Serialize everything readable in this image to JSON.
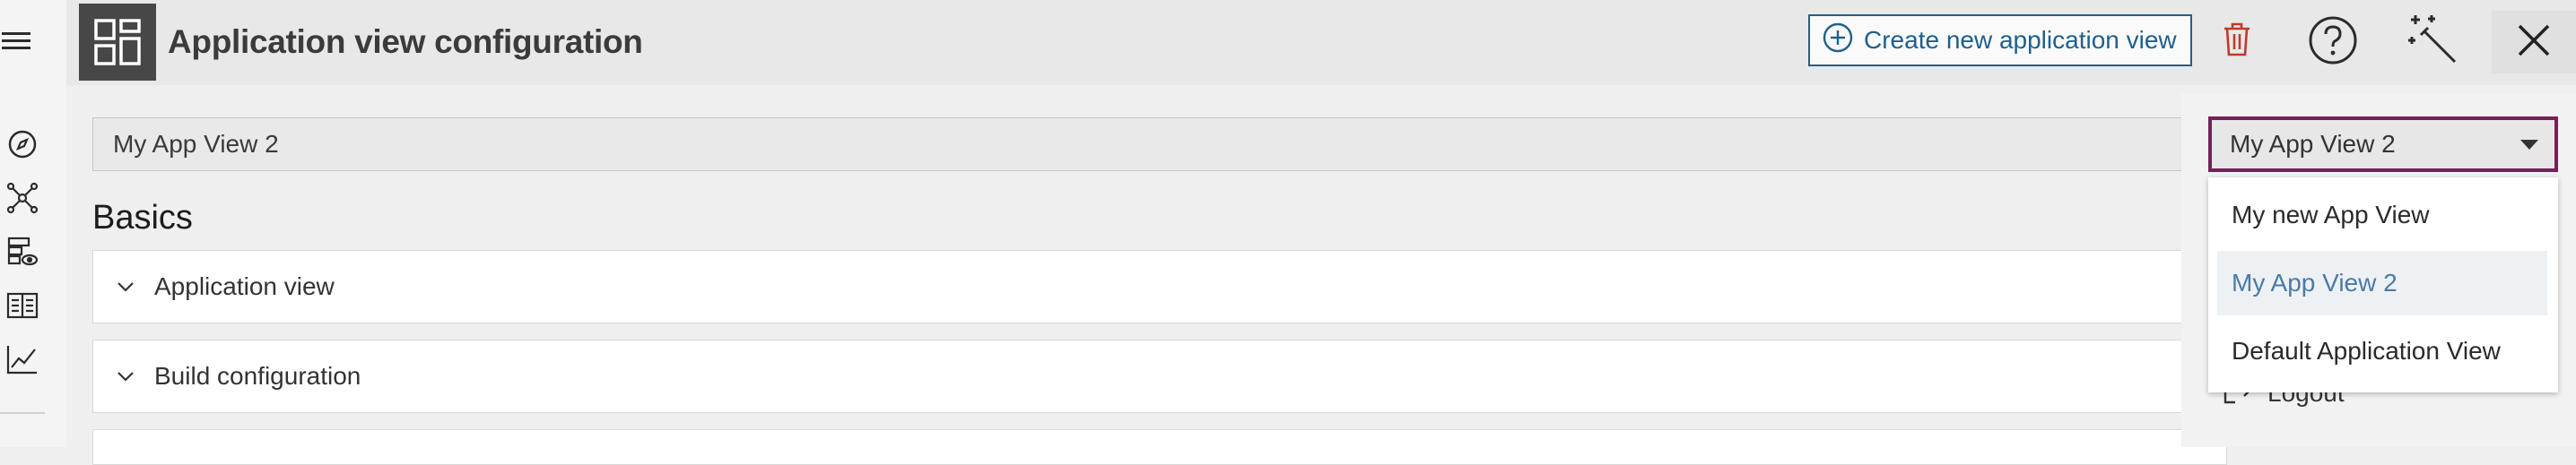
{
  "header": {
    "title": "Application view configuration",
    "create_button_label": "Create new application view"
  },
  "main": {
    "view_name_value": "My App View 2",
    "section_title": "Basics",
    "panels": [
      {
        "label": "Application view"
      },
      {
        "label": "Build configuration"
      }
    ]
  },
  "dropdown": {
    "selected": "My App View 2",
    "options": [
      "My new App View",
      "My App View 2",
      "Default Application View"
    ]
  },
  "user_panel": {
    "logout_label": "Logout"
  },
  "colors": {
    "accent_blue": "#1f5f8d",
    "focus_border": "#7a1e5a",
    "delete_red": "#c0392b",
    "selected_text": "#4a7aa8"
  },
  "icons": [
    "menu-icon",
    "compass-icon",
    "network-icon",
    "server-view-icon",
    "book-icon",
    "chart-icon",
    "dashboard-icon",
    "add-circle-icon",
    "trash-icon",
    "help-icon",
    "magic-wand-icon",
    "close-icon",
    "chevron-down-icon",
    "logout-icon"
  ]
}
